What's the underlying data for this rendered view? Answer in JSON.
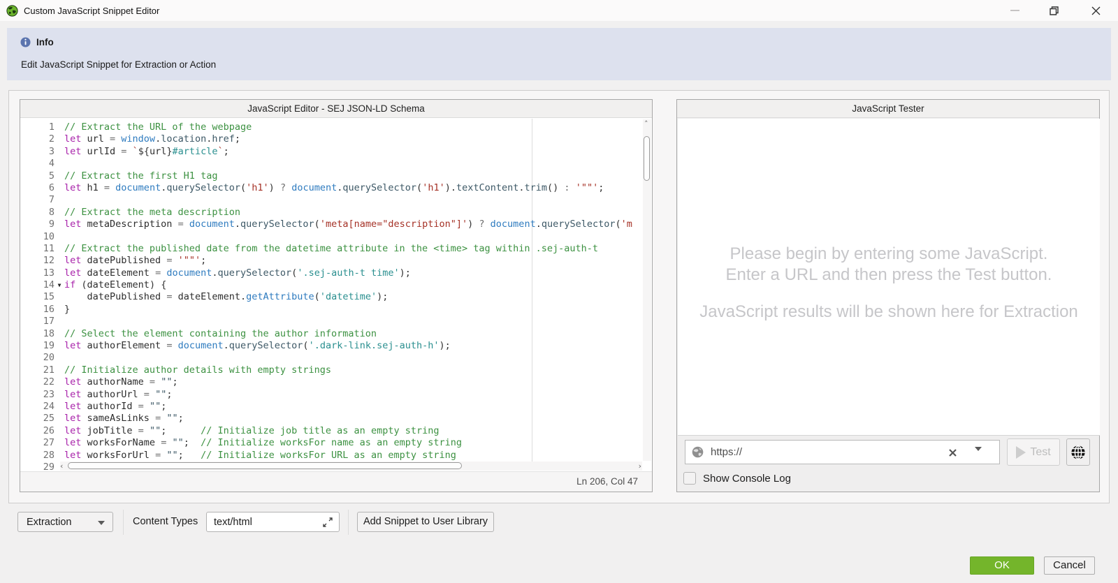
{
  "window": {
    "title": "Custom JavaScript Snippet Editor"
  },
  "info_banner": {
    "title": "Info",
    "description": "Edit JavaScript Snippet for Extraction or Action"
  },
  "editor": {
    "title": "JavaScript Editor - SEJ JSON-LD Schema",
    "status": "Ln 206, Col 47",
    "fold_line": 14,
    "lines": [
      [
        [
          "cm",
          "// Extract the URL of the webpage"
        ]
      ],
      [
        [
          "kw",
          "let "
        ],
        [
          "id",
          "url "
        ],
        [
          "eq",
          "= "
        ],
        [
          "gl",
          "window"
        ],
        [
          "op",
          "."
        ],
        [
          "mt",
          "location"
        ],
        [
          "op",
          "."
        ],
        [
          "mt",
          "href"
        ],
        [
          "op",
          ";"
        ]
      ],
      [
        [
          "kw",
          "let "
        ],
        [
          "id",
          "urlId "
        ],
        [
          "eq",
          "= "
        ],
        [
          "st",
          "`"
        ],
        [
          "op",
          "${"
        ],
        [
          "id",
          "url"
        ],
        [
          "op",
          "}"
        ],
        [
          "sc",
          "#article"
        ],
        [
          "st",
          "`"
        ],
        [
          "op",
          ";"
        ]
      ],
      [],
      [
        [
          "cm",
          "// Extract the first H1 tag"
        ]
      ],
      [
        [
          "kw",
          "let "
        ],
        [
          "id",
          "h1 "
        ],
        [
          "eq",
          "= "
        ],
        [
          "gl",
          "document"
        ],
        [
          "op",
          "."
        ],
        [
          "mt",
          "querySelector"
        ],
        [
          "op",
          "("
        ],
        [
          "st",
          "'h1'"
        ],
        [
          "op",
          ") "
        ],
        [
          "eq",
          "? "
        ],
        [
          "gl",
          "document"
        ],
        [
          "op",
          "."
        ],
        [
          "mt",
          "querySelector"
        ],
        [
          "op",
          "("
        ],
        [
          "st",
          "'h1'"
        ],
        [
          "op",
          ")."
        ],
        [
          "mt",
          "textContent"
        ],
        [
          "op",
          "."
        ],
        [
          "mt",
          "trim"
        ],
        [
          "op",
          "() "
        ],
        [
          "eq",
          ": "
        ],
        [
          "st",
          "'\"\"'"
        ],
        [
          "op",
          ";"
        ]
      ],
      [],
      [
        [
          "cm",
          "// Extract the meta description"
        ]
      ],
      [
        [
          "kw",
          "let "
        ],
        [
          "id",
          "metaDescription "
        ],
        [
          "eq",
          "= "
        ],
        [
          "gl",
          "document"
        ],
        [
          "op",
          "."
        ],
        [
          "mt",
          "querySelector"
        ],
        [
          "op",
          "("
        ],
        [
          "st",
          "'meta[name=\"description\"]'"
        ],
        [
          "op",
          ") "
        ],
        [
          "eq",
          "? "
        ],
        [
          "gl",
          "document"
        ],
        [
          "op",
          "."
        ],
        [
          "mt",
          "querySelector"
        ],
        [
          "op",
          "("
        ],
        [
          "st",
          "'m"
        ]
      ],
      [],
      [
        [
          "cm",
          "// Extract the published date from the datetime attribute in the <time> tag within .sej-auth-t"
        ]
      ],
      [
        [
          "kw",
          "let "
        ],
        [
          "id",
          "datePublished "
        ],
        [
          "eq",
          "= "
        ],
        [
          "st",
          "'\"\"'"
        ],
        [
          "op",
          ";"
        ]
      ],
      [
        [
          "kw",
          "let "
        ],
        [
          "id",
          "dateElement "
        ],
        [
          "eq",
          "= "
        ],
        [
          "gl",
          "document"
        ],
        [
          "op",
          "."
        ],
        [
          "mt",
          "querySelector"
        ],
        [
          "op",
          "("
        ],
        [
          "sc",
          "'.sej-auth-t time'"
        ],
        [
          "op",
          ");"
        ]
      ],
      [
        [
          "kw",
          "if "
        ],
        [
          "op",
          "("
        ],
        [
          "id",
          "dateElement"
        ],
        [
          "op",
          ") {"
        ]
      ],
      [
        [
          "op",
          "    "
        ],
        [
          "id",
          "datePublished "
        ],
        [
          "eq",
          "= "
        ],
        [
          "id",
          "dateElement"
        ],
        [
          "op",
          "."
        ],
        [
          "gl",
          "getAttribute"
        ],
        [
          "op",
          "("
        ],
        [
          "sc",
          "'datetime'"
        ],
        [
          "op",
          ");"
        ]
      ],
      [
        [
          "op",
          "}"
        ]
      ],
      [],
      [
        [
          "cm",
          "// Select the element containing the author information"
        ]
      ],
      [
        [
          "kw",
          "let "
        ],
        [
          "id",
          "authorElement "
        ],
        [
          "eq",
          "= "
        ],
        [
          "gl",
          "document"
        ],
        [
          "op",
          "."
        ],
        [
          "mt",
          "querySelector"
        ],
        [
          "op",
          "("
        ],
        [
          "sc",
          "'.dark-link.sej-auth-h'"
        ],
        [
          "op",
          ");"
        ]
      ],
      [],
      [
        [
          "cm",
          "// Initialize author details with empty strings"
        ]
      ],
      [
        [
          "kw",
          "let "
        ],
        [
          "id",
          "authorName "
        ],
        [
          "eq",
          "= "
        ],
        [
          "mt",
          "\"\""
        ],
        [
          "op",
          ";"
        ]
      ],
      [
        [
          "kw",
          "let "
        ],
        [
          "id",
          "authorUrl "
        ],
        [
          "eq",
          "= "
        ],
        [
          "mt",
          "\"\""
        ],
        [
          "op",
          ";"
        ]
      ],
      [
        [
          "kw",
          "let "
        ],
        [
          "id",
          "authorId "
        ],
        [
          "eq",
          "= "
        ],
        [
          "mt",
          "\"\""
        ],
        [
          "op",
          ";"
        ]
      ],
      [
        [
          "kw",
          "let "
        ],
        [
          "id",
          "sameAsLinks "
        ],
        [
          "eq",
          "= "
        ],
        [
          "mt",
          "\"\""
        ],
        [
          "op",
          ";"
        ]
      ],
      [
        [
          "kw",
          "let "
        ],
        [
          "id",
          "jobTitle "
        ],
        [
          "eq",
          "= "
        ],
        [
          "mt",
          "\"\""
        ],
        [
          "op",
          ";      "
        ],
        [
          "cm",
          "// Initialize job title as an empty string"
        ]
      ],
      [
        [
          "kw",
          "let "
        ],
        [
          "id",
          "worksForName "
        ],
        [
          "eq",
          "= "
        ],
        [
          "mt",
          "\"\""
        ],
        [
          "op",
          ";  "
        ],
        [
          "cm",
          "// Initialize worksFor name as an empty string"
        ]
      ],
      [
        [
          "kw",
          "let "
        ],
        [
          "id",
          "worksForUrl "
        ],
        [
          "eq",
          "= "
        ],
        [
          "mt",
          "\"\""
        ],
        [
          "op",
          ";   "
        ],
        [
          "cm",
          "// Initialize worksFor URL as an empty string"
        ]
      ],
      []
    ]
  },
  "tester": {
    "title": "JavaScript Tester",
    "placeholder_lines": [
      "Please begin by entering some JavaScript.",
      "Enter a URL and then press the Test button.",
      "JavaScript results will be shown here for Extraction"
    ],
    "url_placeholder": "https://",
    "test_label": "Test",
    "show_console_label": "Show Console Log"
  },
  "toolbar": {
    "mode_value": "Extraction",
    "content_types_label": "Content Types",
    "content_types_value": "text/html",
    "add_snippet_label": "Add Snippet to User Library"
  },
  "footer": {
    "ok_label": "OK",
    "cancel_label": "Cancel"
  },
  "colors": {
    "accent_green": "#74b52b",
    "banner_bg": "#dde1ee",
    "syntax": {
      "comment": "#3c9141",
      "keyword": "#a822aa",
      "identifier": "#2d2d2d",
      "global": "#2e7bbf",
      "member": "#3d5866",
      "string": "#a53126",
      "selector_string": "#2a8f8f",
      "operator": "#333333"
    }
  }
}
